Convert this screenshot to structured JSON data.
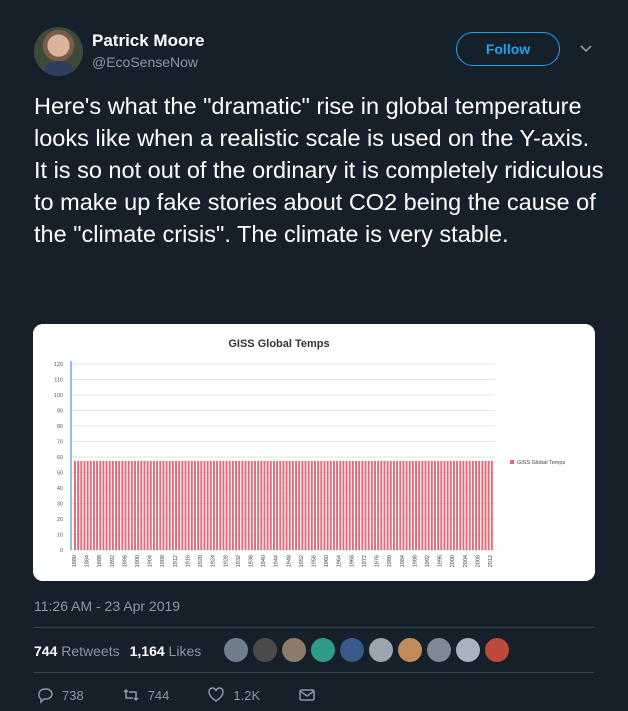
{
  "author": {
    "name": "Patrick Moore",
    "handle": "@EcoSenseNow"
  },
  "follow_label": "Follow",
  "tweet_text": "Here's what the \"dramatic\" rise in global temperature looks like when a realistic scale is used on the Y-axis. It is so not out of the ordinary it is completely ridiculous to make up fake stories about CO2 being the cause of the \"climate crisis\". The climate is very stable.",
  "timestamp": "11:26 AM - 23 Apr 2019",
  "stats": {
    "retweets_count": "744",
    "retweets_label": "Retweets",
    "likes_count": "1,164",
    "likes_label": "Likes"
  },
  "actions": {
    "replies": "738",
    "retweets": "744",
    "likes": "1.2K"
  },
  "colors": {
    "background": "#15202b",
    "accent": "#1da1f2",
    "bar": "#e06c7a"
  },
  "liker_colors": [
    "#6e7e8c",
    "#4a4a4a",
    "#8c7a6a",
    "#2f9c8a",
    "#3a5a8c",
    "#9aa5b0",
    "#c08a5a",
    "#7d8a96",
    "#a8b4bf",
    "#c04a3a"
  ],
  "chart_data": {
    "type": "bar",
    "title": "GISS Global Temps",
    "legend": "GISS Global Temps",
    "legend_position": "right",
    "grid": true,
    "ylim": [
      0,
      120
    ],
    "yticks": [
      0,
      10,
      20,
      30,
      40,
      50,
      60,
      70,
      80,
      90,
      100,
      110,
      120
    ],
    "xtick_labels": [
      "1880",
      "1884",
      "1888",
      "1892",
      "1896",
      "1900",
      "1904",
      "1908",
      "1912",
      "1916",
      "1920",
      "1924",
      "1928",
      "1932",
      "1936",
      "1940",
      "1944",
      "1948",
      "1952",
      "1956",
      "1960",
      "1964",
      "1968",
      "1972",
      "1976",
      "1980",
      "1984",
      "1988",
      "1992",
      "1996",
      "2000",
      "2004",
      "2008",
      "2012"
    ],
    "categories_start": 1880,
    "categories_end": 2012,
    "values_approx": 57.5
  }
}
